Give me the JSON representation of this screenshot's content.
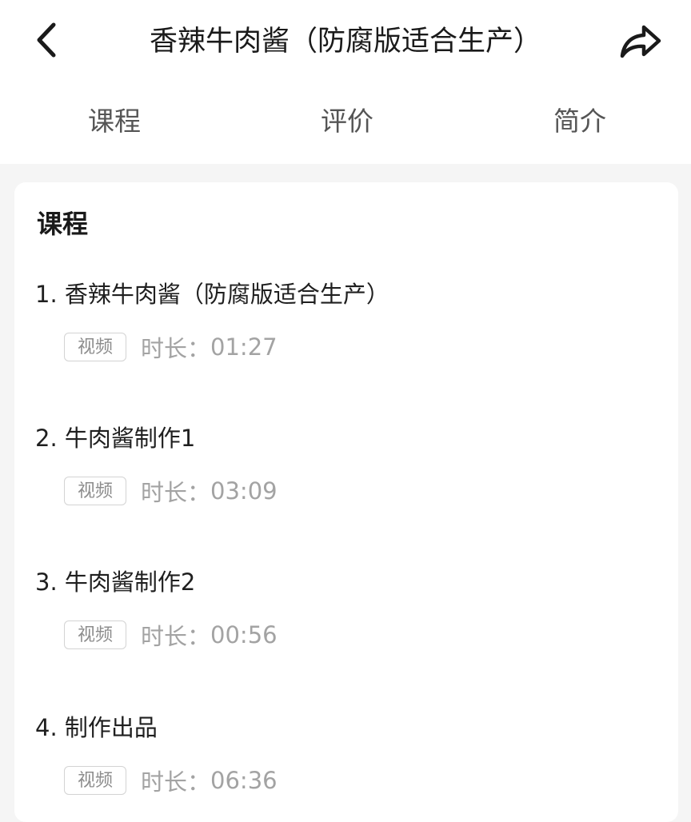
{
  "header": {
    "title": "香辣牛肉酱（防腐版适合生产）",
    "back_icon": "chevron-left-icon",
    "share_icon": "share-arrow-icon"
  },
  "tabs": [
    {
      "label": "课程"
    },
    {
      "label": "评价"
    },
    {
      "label": "简介"
    }
  ],
  "course": {
    "section_title": "课程",
    "duration_label": "时长：",
    "lessons": [
      {
        "title": "1. 香辣牛肉酱（防腐版适合生产）",
        "type": "视频",
        "duration": "01:27"
      },
      {
        "title": "2. 牛肉酱制作1",
        "type": "视频",
        "duration": "03:09"
      },
      {
        "title": "3. 牛肉酱制作2",
        "type": "视频",
        "duration": "00:56"
      },
      {
        "title": "4. 制作出品",
        "type": "视频",
        "duration": "06:36"
      }
    ]
  },
  "colors": {
    "text_primary": "#1a1a1a",
    "text_secondary": "#555555",
    "text_muted": "#a3a3a3",
    "background": "#f5f5f5",
    "card": "#ffffff"
  }
}
